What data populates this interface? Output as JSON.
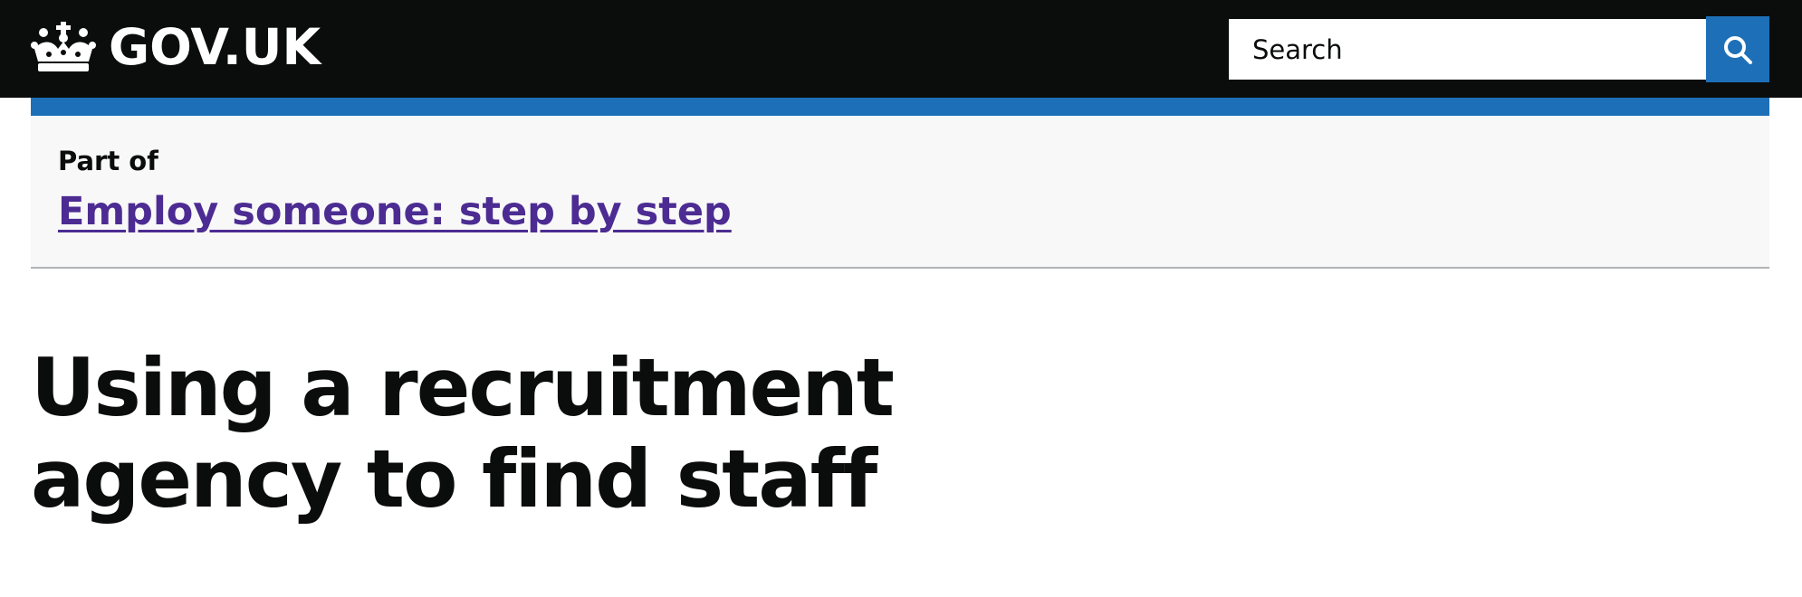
{
  "header": {
    "logo_text": "GOV.UK",
    "logo_icon": "crown-icon",
    "background_color": "#0b0c0c",
    "search": {
      "placeholder": "Search",
      "button_icon": "search-icon",
      "button_color": "#1d70b8"
    }
  },
  "accent_color": "#1d70b8",
  "part_of": {
    "label": "Part of",
    "link_text": "Employ someone: step by step",
    "link_color": "#4c2c92"
  },
  "main": {
    "title": "Using a recruitment agency to find staff"
  }
}
